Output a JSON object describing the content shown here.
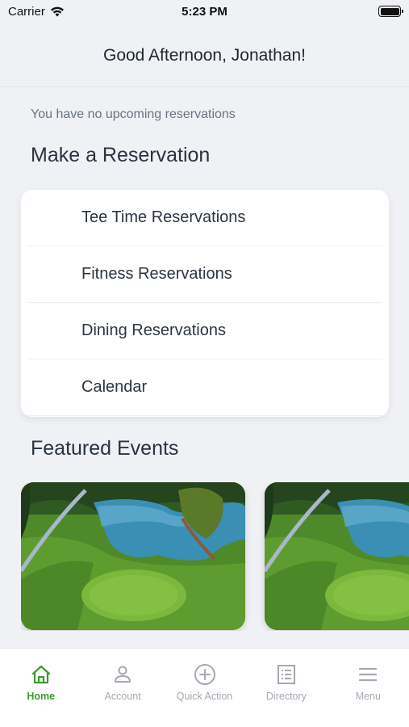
{
  "status_bar": {
    "carrier": "Carrier",
    "time": "5:23 PM"
  },
  "header": {
    "greeting": "Good Afternoon, Jonathan!"
  },
  "notice": "You have no upcoming reservations",
  "reservations": {
    "title": "Make a Reservation",
    "items": [
      {
        "label": "Tee Time Reservations"
      },
      {
        "label": "Fitness Reservations"
      },
      {
        "label": "Dining Reservations"
      },
      {
        "label": "Calendar"
      }
    ]
  },
  "events": {
    "title": "Featured Events"
  },
  "tabs": [
    {
      "label": "Home",
      "icon": "home-icon",
      "active": true
    },
    {
      "label": "Account",
      "icon": "user-icon",
      "active": false
    },
    {
      "label": "Quick Action",
      "icon": "plus-circle-icon",
      "active": false
    },
    {
      "label": "Directory",
      "icon": "directory-icon",
      "active": false
    },
    {
      "label": "Menu",
      "icon": "menu-icon",
      "active": false
    }
  ],
  "colors": {
    "accent": "#3d9a2e",
    "background": "#eff1f4",
    "inactive": "#a4a9b1"
  }
}
